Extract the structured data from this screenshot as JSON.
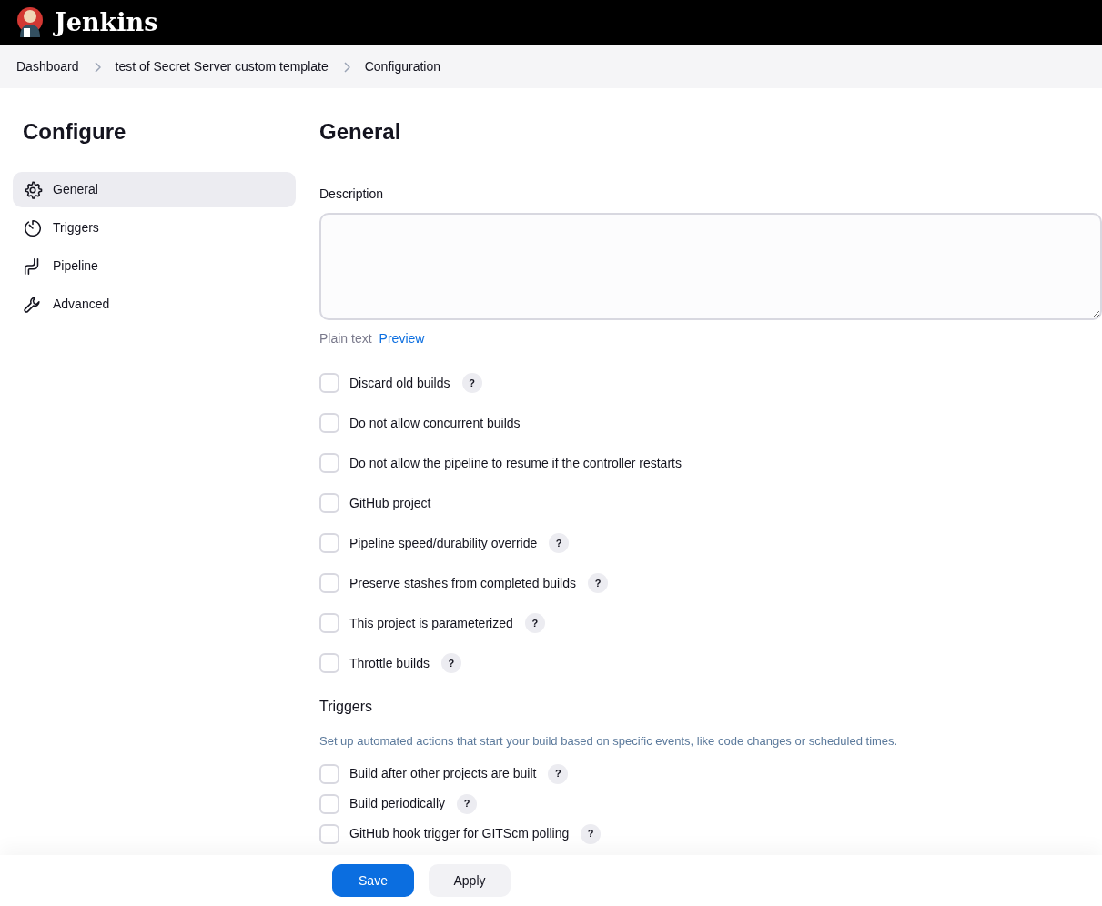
{
  "header": {
    "title": "Jenkins"
  },
  "breadcrumbs": [
    "Dashboard",
    "test of Secret Server custom template",
    "Configuration"
  ],
  "sidebar": {
    "title": "Configure",
    "items": [
      {
        "label": "General",
        "selected": true
      },
      {
        "label": "Triggers",
        "selected": false
      },
      {
        "label": "Pipeline",
        "selected": false
      },
      {
        "label": "Advanced",
        "selected": false
      }
    ]
  },
  "main": {
    "title": "General",
    "description": {
      "label": "Description",
      "format_label": "Plain text",
      "preview_link": "Preview"
    },
    "options": [
      {
        "label": "Discard old builds",
        "checked": false,
        "help": "?"
      },
      {
        "label": "Do not allow concurrent builds",
        "checked": false
      },
      {
        "label": "Do not allow the pipeline to resume if the controller restarts",
        "checked": false
      },
      {
        "label": "GitHub project",
        "checked": false
      },
      {
        "label": "Pipeline speed/durability override",
        "checked": false,
        "help": "?"
      },
      {
        "label": "Preserve stashes from completed builds",
        "checked": false,
        "help": "?"
      },
      {
        "label": "This project is parameterized",
        "checked": false,
        "help": "?"
      },
      {
        "label": "Throttle builds",
        "checked": false,
        "help": "?"
      }
    ],
    "triggers": {
      "title": "Triggers",
      "description": "Set up automated actions that start your build based on specific events, like code changes or scheduled times.",
      "options": [
        {
          "label": "Build after other projects are built",
          "checked": false,
          "help": "?"
        },
        {
          "label": "Build periodically",
          "checked": false,
          "help": "?"
        },
        {
          "label": "GitHub hook trigger for GITScm polling",
          "checked": false,
          "help": "?"
        }
      ]
    }
  },
  "footer": {
    "buttons": [
      "Save",
      "Apply"
    ]
  }
}
